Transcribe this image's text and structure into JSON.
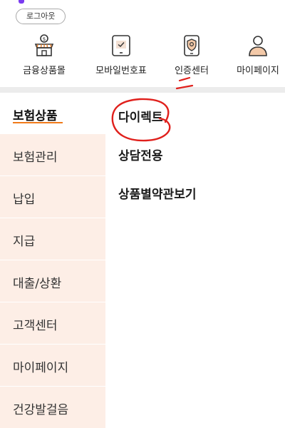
{
  "header": {
    "logout_label": "로그아웃",
    "accent_color": "#7a3cf0"
  },
  "quick_menu": [
    {
      "label": "금융상품몰",
      "icon": "store-icon"
    },
    {
      "label": "모바일번호표",
      "icon": "tablet-ticket-icon"
    },
    {
      "label": "인증센터",
      "icon": "shield-phone-icon"
    },
    {
      "label": "마이페이지",
      "icon": "person-icon"
    }
  ],
  "sidebar": {
    "items": [
      {
        "label": "보험상품",
        "active": true
      },
      {
        "label": "보험관리"
      },
      {
        "label": "납입"
      },
      {
        "label": "지급"
      },
      {
        "label": "대출/상환"
      },
      {
        "label": "고객센터"
      },
      {
        "label": "마이페이지"
      },
      {
        "label": "건강발걸음"
      }
    ],
    "active_underline_color": "#f07a1a",
    "inactive_bg": "#fdeee6"
  },
  "submenu": {
    "items": [
      {
        "label": "다이렉트"
      },
      {
        "label": "상담전용"
      },
      {
        "label": "상품별약관보기"
      }
    ]
  },
  "annotation": {
    "color": "#e0201c"
  }
}
